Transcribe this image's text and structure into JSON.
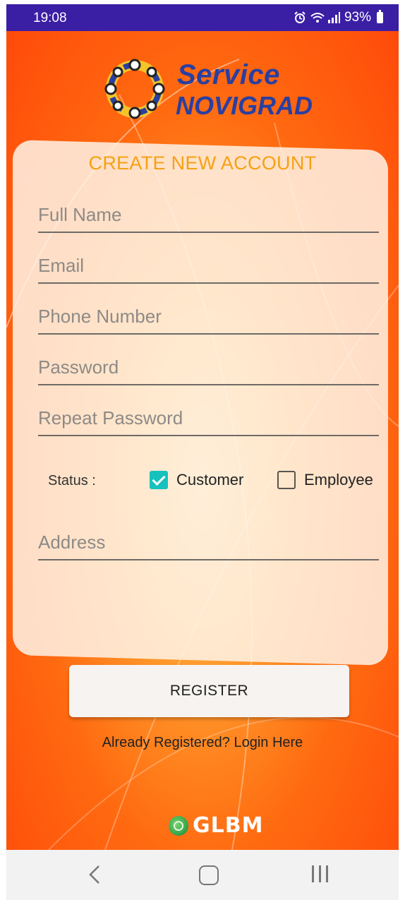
{
  "status_bar": {
    "time": "19:08",
    "battery": "93%"
  },
  "logo": {
    "line1": "Service",
    "line2": "NOVIGRAD"
  },
  "form": {
    "title": "CREATE NEW ACCOUNT",
    "full_name_placeholder": "Full Name",
    "email_placeholder": "Email",
    "phone_placeholder": "Phone Number",
    "password_placeholder": "Password",
    "repeat_password_placeholder": "Repeat Password",
    "status_label": "Status :",
    "options": [
      {
        "label": "Customer",
        "checked": true
      },
      {
        "label": "Employee",
        "checked": false
      }
    ],
    "address_placeholder": "Address"
  },
  "actions": {
    "register_label": "REGISTER",
    "login_link": "Already Registered? Login Here"
  },
  "footer": {
    "brand": "GLBM"
  },
  "colors": {
    "status_bar_bg": "#3a1fa4",
    "title_orange": "#f5a113",
    "checkbox_teal": "#17c1be",
    "logo_blue": "#2a3fa0"
  }
}
